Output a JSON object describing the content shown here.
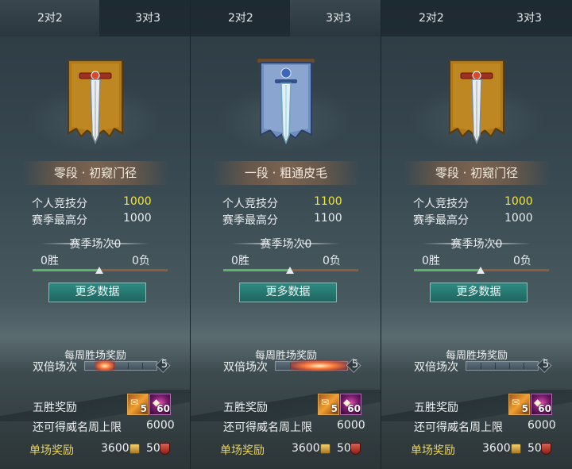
{
  "colors": {
    "highlight": "#f1e63a",
    "button": "#2a7a74",
    "single_reward_label": "#e9d45a",
    "win_bar": "#5cb564",
    "loss_bar": "#8c5c3c"
  },
  "panels": [
    {
      "tabs": {
        "left": "2对2",
        "right": "3对3",
        "active": "left"
      },
      "emblem": "gold-banner-sword-icon",
      "rank": "零段 · 初窥门径",
      "personal_score_label": "个人竞技分",
      "personal_score": "1000",
      "season_high_label": "赛季最高分",
      "season_high": "1000",
      "season_matches": "赛季场次0",
      "wins": "0胜",
      "losses": "0负",
      "win_ratio": 0.5,
      "more_button": "更多数据",
      "weekly_title": "每周胜场奖励",
      "double_label": "双倍场次",
      "double_count": "5",
      "double_progress": 0.35,
      "five_win_label": "五胜奖励",
      "item_a_icon": "orange-scroll-icon",
      "item_a_count": "5",
      "item_b_icon": "purple-gem-icon",
      "item_b_count": "60",
      "fame_cap_label": "还可得威名周上限",
      "fame_cap": "6000",
      "single_reward_label": "单场奖励",
      "single_reward_coins": "3600",
      "single_reward_fame": "50"
    },
    {
      "tabs": {
        "left": "2对2",
        "right": "3对3",
        "active": "right"
      },
      "emblem": "blue-banner-sword-icon",
      "rank": "一段 · 粗通皮毛",
      "personal_score_label": "个人竞技分",
      "personal_score": "1100",
      "season_high_label": "赛季最高分",
      "season_high": "1100",
      "season_matches": "赛季场次0",
      "wins": "0胜",
      "losses": "0负",
      "win_ratio": 0.5,
      "more_button": "更多数据",
      "weekly_title": "每周胜场奖励",
      "double_label": "双倍场次",
      "double_count": "5",
      "double_progress": 1.0,
      "five_win_label": "五胜奖励",
      "item_a_icon": "orange-scroll-icon",
      "item_a_count": "5",
      "item_b_icon": "purple-gem-icon",
      "item_b_count": "60",
      "fame_cap_label": "还可得威名周上限",
      "fame_cap": "6000",
      "single_reward_label": "单场奖励",
      "single_reward_coins": "3600",
      "single_reward_fame": "50"
    },
    {
      "tabs": {
        "left": "2对2",
        "right": "3对3",
        "active": "none"
      },
      "emblem": "gold-banner-sword-icon",
      "rank": "零段 · 初窥门径",
      "personal_score_label": "个人竞技分",
      "personal_score": "1000",
      "season_high_label": "赛季最高分",
      "season_high": "1000",
      "season_matches": "赛季场次0",
      "wins": "0胜",
      "losses": "0负",
      "win_ratio": 0.5,
      "more_button": "更多数据",
      "weekly_title": "每周胜场奖励",
      "double_label": "双倍场次",
      "double_count": "5",
      "double_progress": 0.0,
      "five_win_label": "五胜奖励",
      "item_a_icon": "orange-scroll-icon",
      "item_a_count": "5",
      "item_b_icon": "purple-gem-icon",
      "item_b_count": "60",
      "fame_cap_label": "还可得威名周上限",
      "fame_cap": "6000",
      "single_reward_label": "单场奖励",
      "single_reward_coins": "3600",
      "single_reward_fame": "50"
    }
  ]
}
